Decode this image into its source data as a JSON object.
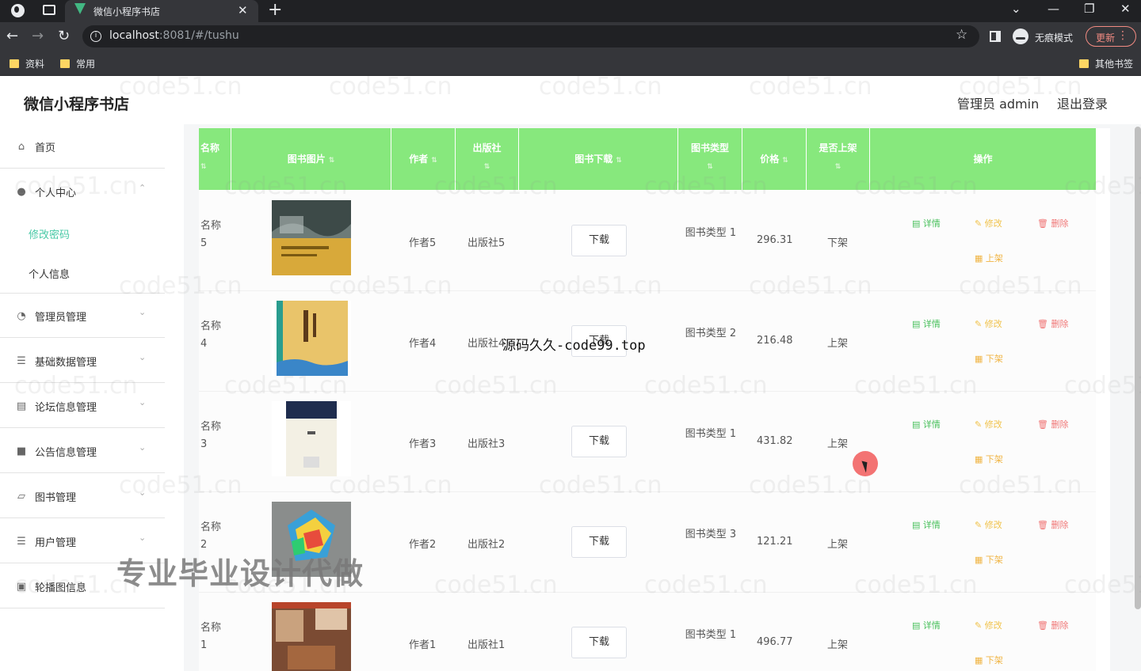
{
  "browser": {
    "tab_title": "微信小程序书店",
    "tab_close": "✕",
    "new_tab": "+",
    "url_host": "localhost",
    "url_rest": ":8081/#/tushu",
    "incognito_label": "无痕模式",
    "update_label": "更新",
    "bookmarks": [
      "资料",
      "常用"
    ],
    "other_bookmarks": "其他书签"
  },
  "app": {
    "brand": "微信小程序书店",
    "admin_label": "管理员 admin",
    "logout_label": "退出登录"
  },
  "sidebar": {
    "items": [
      {
        "icon": "home-icon",
        "glyph": "⌂",
        "label": "首页"
      },
      {
        "icon": "user-icon",
        "glyph": "●",
        "label": "个人中心"
      },
      {
        "icon": "manager-icon",
        "glyph": "◔",
        "label": "管理员管理"
      },
      {
        "icon": "sliders-icon",
        "glyph": "☰",
        "label": "基础数据管理"
      },
      {
        "icon": "forum-icon",
        "glyph": "▤",
        "label": "论坛信息管理"
      },
      {
        "icon": "notice-icon",
        "glyph": "■",
        "label": "公告信息管理"
      },
      {
        "icon": "book-icon",
        "glyph": "▱",
        "label": "图书管理"
      },
      {
        "icon": "users-icon",
        "glyph": "☰",
        "label": "用户管理"
      },
      {
        "icon": "carousel-icon",
        "glyph": "▣",
        "label": "轮播图信息"
      }
    ],
    "subitems": [
      {
        "label": "修改密码",
        "active": true
      },
      {
        "label": "个人信息",
        "active": false
      }
    ],
    "caret": "⌄",
    "caret_up": "⌃"
  },
  "table": {
    "headers": {
      "name": "名称",
      "image": "图书图片",
      "author": "作者",
      "publisher": "出版社",
      "download": "图书下载",
      "type": "图书类型",
      "price": "价格",
      "on_shelf": "是否上架",
      "actions": "操作"
    },
    "sort_glyph": "⇅",
    "rows": [
      {
        "name": "名称 5",
        "author": "作者5",
        "publisher": "出版社5",
        "download": "下载",
        "type": "图书类型 1",
        "price": "296.31",
        "status": "下架",
        "shelf_action": "上架",
        "cover": "cover-dark"
      },
      {
        "name": "名称 4",
        "author": "作者4",
        "publisher": "出版社4",
        "download": "下载",
        "type": "图书类型 2",
        "price": "216.48",
        "status": "上架",
        "shelf_action": "下架",
        "cover": "cover-yellow"
      },
      {
        "name": "名称 3",
        "author": "作者3",
        "publisher": "出版社3",
        "download": "下载",
        "type": "图书类型 1",
        "price": "431.82",
        "status": "上架",
        "shelf_action": "下架",
        "cover": "cover-navy"
      },
      {
        "name": "名称 2",
        "author": "作者2",
        "publisher": "出版社2",
        "download": "下载",
        "type": "图书类型 3",
        "price": "121.21",
        "status": "上架",
        "shelf_action": "下架",
        "cover": "cover-colorful"
      },
      {
        "name": "名称 1",
        "author": "作者1",
        "publisher": "出版社1",
        "download": "下载",
        "type": "图书类型 1",
        "price": "496.77",
        "status": "上架",
        "shelf_action": "下架",
        "cover": "cover-photo"
      }
    ],
    "actions": {
      "detail": "详情",
      "edit": "修改",
      "delete": "删除",
      "detail_glyph": "▤",
      "edit_glyph": "✎",
      "delete_glyph": "🗑",
      "shelf_glyph": "▦"
    }
  },
  "overlays": {
    "watermark": "code51.cn",
    "source_text": "源码久久-code99.top",
    "promo_text": "专业毕业设计代做"
  }
}
